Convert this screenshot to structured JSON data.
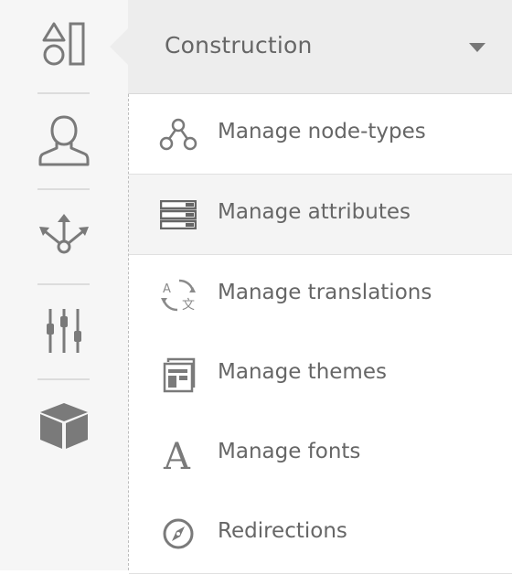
{
  "rail": {
    "items": [
      {
        "name": "shapes",
        "icon": "shapes-icon",
        "active": true
      },
      {
        "name": "users",
        "icon": "user-icon"
      },
      {
        "name": "share",
        "icon": "share-arrows-icon"
      },
      {
        "name": "settings",
        "icon": "sliders-icon"
      },
      {
        "name": "modules",
        "icon": "cube-icon"
      }
    ]
  },
  "header": {
    "title": "Construction",
    "dropdown_icon": "caret-down-icon"
  },
  "menu": {
    "items": [
      {
        "label": "Manage node-types",
        "icon": "node-types-icon"
      },
      {
        "label": "Manage attributes",
        "icon": "attributes-icon",
        "active": true
      },
      {
        "label": "Manage translations",
        "icon": "translations-icon"
      },
      {
        "label": "Manage themes",
        "icon": "themes-icon"
      },
      {
        "label": "Manage fonts",
        "icon": "fonts-icon"
      },
      {
        "label": "Redirections",
        "icon": "compass-icon"
      }
    ]
  },
  "colors": {
    "rail_bg": "#f6f6f6",
    "header_bg": "#ededed",
    "active_row_bg": "#f4f4f4",
    "text": "#666666",
    "icon": "#7a7a7a"
  }
}
